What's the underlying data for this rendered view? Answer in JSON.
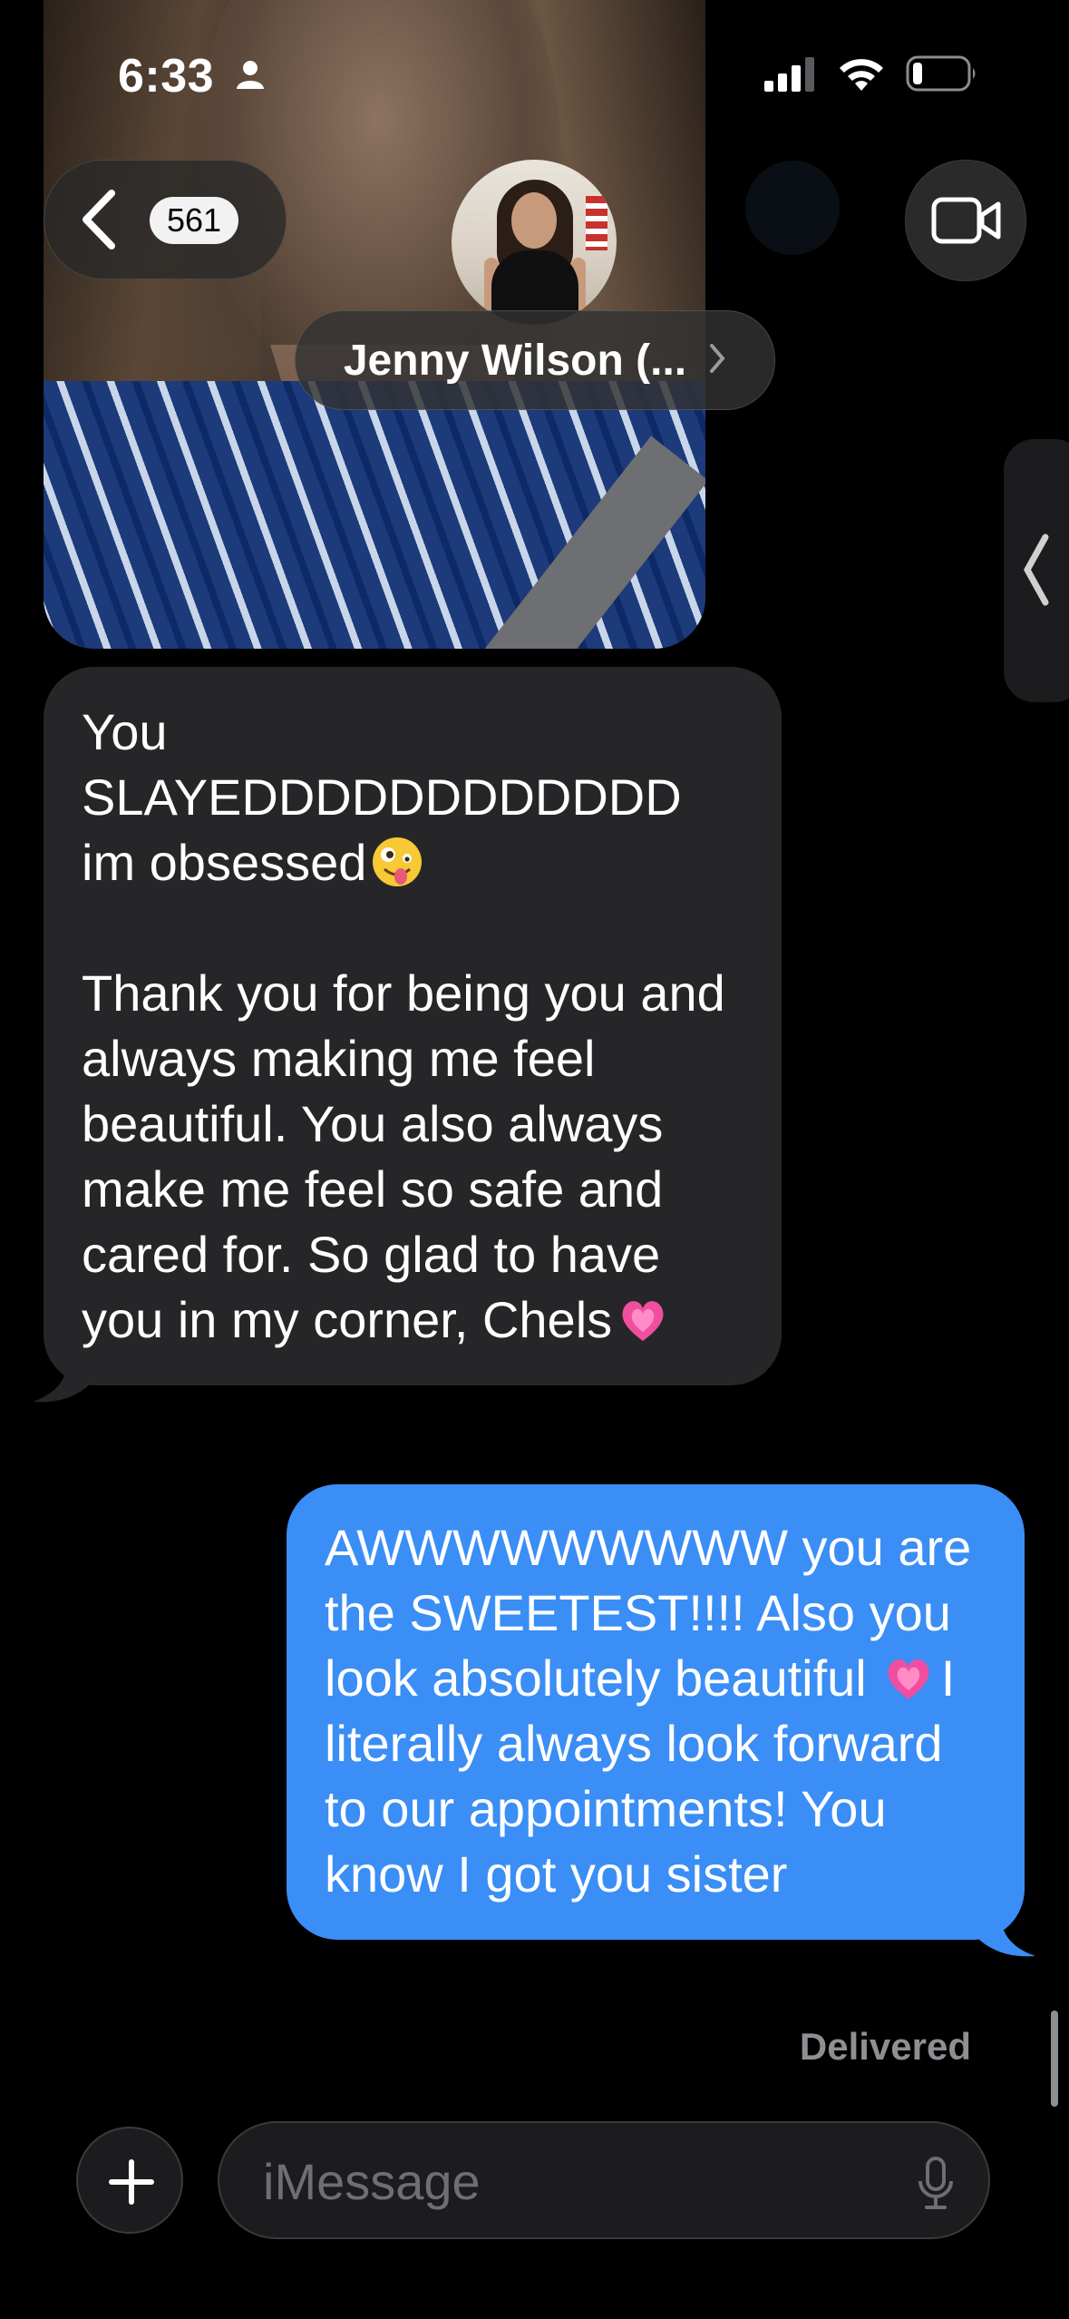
{
  "status_bar": {
    "time": "6:33",
    "icons": [
      "person-icon",
      "signal-icon",
      "wifi-icon",
      "battery-icon"
    ]
  },
  "nav": {
    "unread_count": "561",
    "contact_name": "Jenny Wilson (...",
    "icons": [
      "back-chevron-icon",
      "video-call-icon",
      "chevron-right-icon"
    ]
  },
  "messages": {
    "received": {
      "lines": [
        "You",
        "SLAYEDDDDDDDDDDDD",
        "im obsessed",
        "",
        "Thank you for being you and always making me feel beautiful. You also always make me feel so safe and cared for. So glad to have you in my corner, Chels"
      ],
      "emoji_after_obsessed": "zany-face-emoji",
      "emoji_end": "growing-heart-emoji"
    },
    "sent": {
      "text_before_emoji": "AWWWWWWWWW you are the SWEETEST!!!! Also you look absolutely beautiful",
      "text_after_emoji": "I literally always look forward to our appointments! You know I got you sister",
      "emoji": "growing-heart-emoji"
    },
    "status": "Delivered"
  },
  "composer": {
    "placeholder": "iMessage",
    "icons": [
      "plus-icon",
      "microphone-icon"
    ]
  },
  "colors": {
    "background": "#000000",
    "received_bubble": "#262628",
    "sent_bubble": "#3a8ef6",
    "secondary_text": "#8e8e93"
  }
}
